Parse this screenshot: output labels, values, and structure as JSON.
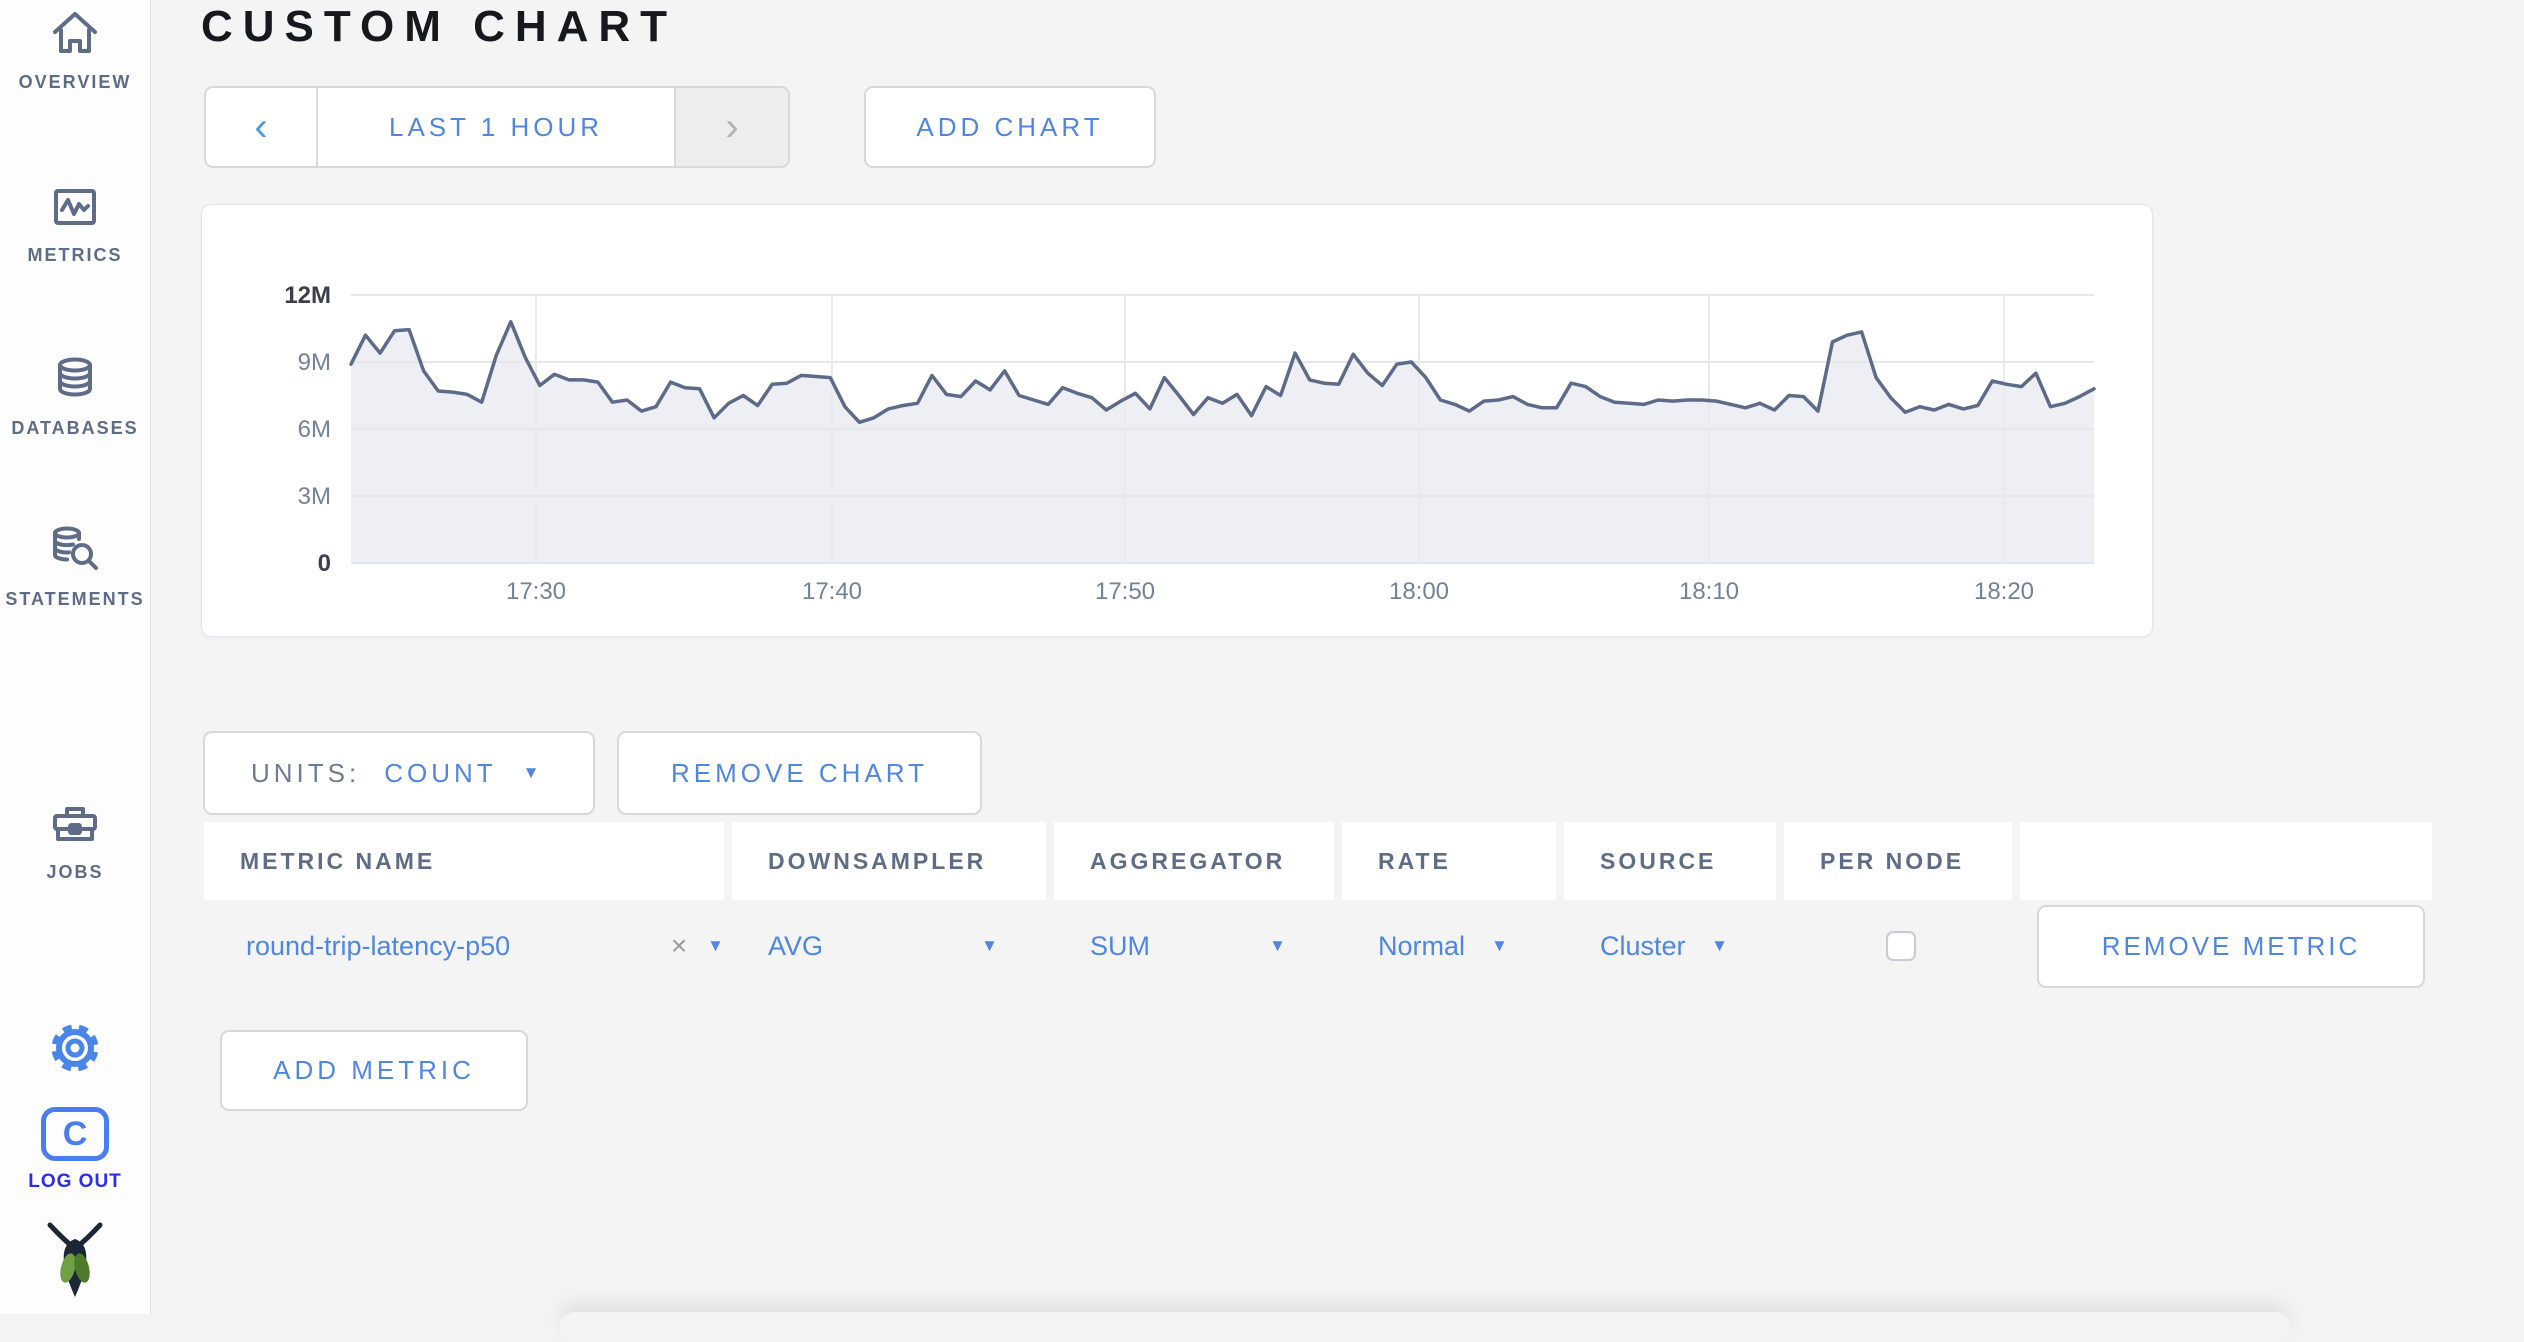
{
  "page_title": "CUSTOM CHART",
  "glyphs": {
    "caret": "▼",
    "prev": "‹",
    "next": "›",
    "clear": "×"
  },
  "sidebar": {
    "items": [
      {
        "label": "OVERVIEW",
        "icon": "home-icon"
      },
      {
        "label": "METRICS",
        "icon": "metrics-icon"
      },
      {
        "label": "DATABASES",
        "icon": "database-icon"
      },
      {
        "label": "STATEMENTS",
        "icon": "statements-icon"
      },
      {
        "label": "JOBS",
        "icon": "jobs-icon"
      }
    ],
    "logout_label": "LOG OUT",
    "logo_letter": "C"
  },
  "toolbar": {
    "time_range_label": "LAST 1 HOUR",
    "add_chart_label": "ADD CHART"
  },
  "chart_data": {
    "type": "area",
    "title": "",
    "x_ticks": [
      "17:30",
      "17:40",
      "17:50",
      "18:00",
      "18:10",
      "18:20"
    ],
    "y_ticks": [
      "0",
      "3M",
      "6M",
      "9M",
      "12M"
    ],
    "ylim_m": [
      0,
      12
    ],
    "x_range": [
      "17:24",
      "18:23"
    ],
    "grid": true,
    "legend": "none",
    "style": {
      "line": "#5d6a88",
      "fill": "#edeff4"
    },
    "series": [
      {
        "name": "round-trip-latency-p50",
        "units": "count",
        "values_m": [
          8.9,
          10.2,
          9.4,
          10.4,
          10.45,
          8.6,
          7.7,
          7.65,
          7.55,
          7.2,
          9.3,
          10.8,
          9.2,
          7.95,
          8.45,
          8.2,
          8.2,
          8.1,
          7.2,
          7.3,
          6.8,
          7.0,
          8.1,
          7.85,
          7.8,
          6.5,
          7.15,
          7.5,
          7.05,
          8.0,
          8.05,
          8.4,
          8.35,
          8.3,
          7.0,
          6.3,
          6.5,
          6.9,
          7.05,
          7.15,
          8.4,
          7.55,
          7.45,
          8.15,
          7.75,
          8.6,
          7.5,
          7.3,
          7.1,
          7.85,
          7.6,
          7.4,
          6.85,
          7.25,
          7.6,
          6.9,
          8.3,
          7.5,
          6.65,
          7.4,
          7.15,
          7.55,
          6.6,
          7.9,
          7.5,
          9.4,
          8.2,
          8.05,
          8.0,
          9.35,
          8.5,
          7.95,
          8.9,
          9.0,
          8.3,
          7.3,
          7.1,
          6.8,
          7.25,
          7.3,
          7.45,
          7.1,
          6.95,
          6.95,
          8.05,
          7.9,
          7.45,
          7.2,
          7.15,
          7.1,
          7.3,
          7.25,
          7.3,
          7.3,
          7.25,
          7.1,
          6.95,
          7.15,
          6.85,
          7.5,
          7.45,
          6.8,
          9.9,
          10.2,
          10.35,
          8.3,
          7.4,
          6.75,
          7.0,
          6.85,
          7.1,
          6.9,
          7.05,
          8.15,
          8.0,
          7.9,
          8.5,
          7.0,
          7.15,
          7.45,
          7.8
        ]
      }
    ]
  },
  "units_bar": {
    "units_label": "UNITS:",
    "units_value": "COUNT",
    "remove_chart_label": "REMOVE CHART"
  },
  "metric_table": {
    "headers": [
      "METRIC NAME",
      "DOWNSAMPLER",
      "AGGREGATOR",
      "RATE",
      "SOURCE",
      "PER NODE"
    ],
    "row": {
      "metric_name": "round-trip-latency-p50",
      "downsampler": "AVG",
      "aggregator": "SUM",
      "rate": "Normal",
      "source": "Cluster",
      "per_node_checked": false,
      "remove_label": "REMOVE METRIC"
    },
    "add_metric_label": "ADD METRIC"
  },
  "colors": {
    "accent_blue": "#4f87e0",
    "slate": "#5f6c87",
    "logout_blue": "#2b2bf2",
    "line": "#5d6a88",
    "area_fill": "#edeff4",
    "page_bg": "#f4f4f5",
    "leaf_green": "#6fa045"
  }
}
